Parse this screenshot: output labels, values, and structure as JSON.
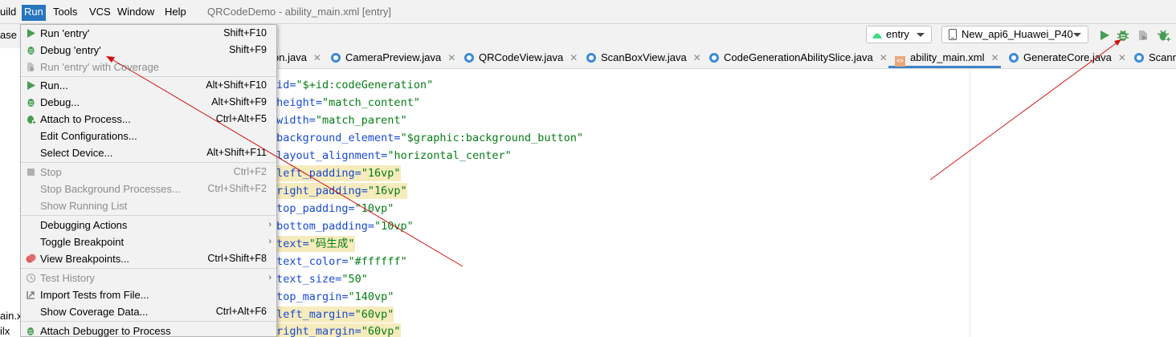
{
  "menubar": {
    "items": [
      "uild",
      "Run",
      "Tools",
      "VCS",
      "Window",
      "Help"
    ],
    "window_title": "QRCodeDemo - ability_main.xml [entry]"
  },
  "toolbar": {
    "left_text": "ase",
    "module_combo": "entry",
    "device_combo": "New_api6_Huawei_P40"
  },
  "tabs": [
    {
      "label": "on.java",
      "icon": "java-class-icon"
    },
    {
      "label": "CameraPreview.java",
      "icon": "java-class-icon"
    },
    {
      "label": "QRCodeView.java",
      "icon": "java-class-icon"
    },
    {
      "label": "ScanBoxView.java",
      "icon": "java-class-icon"
    },
    {
      "label": "CodeGenerationAbilitySlice.java",
      "icon": "java-class-icon"
    },
    {
      "label": "ability_main.xml",
      "icon": "xml-file-icon",
      "active": true
    },
    {
      "label": "GenerateCore.java",
      "icon": "java-class-icon"
    },
    {
      "label": "Scann",
      "icon": "java-class-icon"
    }
  ],
  "code": [
    {
      "attr": ":id=",
      "val": "\"$+id:codeGeneration\"",
      "hl": false
    },
    {
      "attr": ":height=",
      "val": "\"match_content\"",
      "hl": false
    },
    {
      "attr": ":width=",
      "val": "\"match_parent\"",
      "hl": false
    },
    {
      "attr": ":background_element=",
      "val": "\"$graphic:background_button\"",
      "hl": false
    },
    {
      "attr": ":layout_alignment=",
      "val": "\"horizontal_center\"",
      "hl": false
    },
    {
      "attr": ":left_padding=",
      "val": "\"16vp\"",
      "hl": true
    },
    {
      "attr": ":right_padding=",
      "val": "\"16vp\"",
      "hl": true
    },
    {
      "attr": ":top_padding=",
      "val": "\"10vp\"",
      "hl": false
    },
    {
      "attr": ":bottom_padding=",
      "val": "\"10vp\"",
      "hl": false
    },
    {
      "attr": ":text=",
      "val": "\"码生成\"",
      "hl": true
    },
    {
      "attr": ":text_color=",
      "val": "\"#ffffff\"",
      "hl": false
    },
    {
      "attr": ":text_size=",
      "val": "\"50\"",
      "hl": false
    },
    {
      "attr": ":top_margin=",
      "val": "\"140vp\"",
      "hl": false
    },
    {
      "attr": ":left_margin=",
      "val": "\"60vp\"",
      "hl": true
    },
    {
      "attr": ":right_margin=",
      "val": "\"60vp\"",
      "hl": true
    }
  ],
  "left_peek": {
    "line1": "ain.x",
    "line2": "ilx"
  },
  "run_menu": {
    "items": [
      {
        "label": "Run 'entry'",
        "shortcut": "Shift+F10",
        "icon": "run-icon",
        "disabled": false
      },
      {
        "label": "Debug 'entry'",
        "shortcut": "Shift+F9",
        "icon": "debug-icon",
        "disabled": false
      },
      {
        "label": "Run 'entry' with Coverage",
        "shortcut": "",
        "icon": "coverage-icon",
        "disabled": true
      },
      {
        "label": "Run...",
        "shortcut": "Alt+Shift+F10",
        "icon": "run-icon",
        "disabled": false
      },
      {
        "label": "Debug...",
        "shortcut": "Alt+Shift+F9",
        "icon": "debug-icon",
        "disabled": false
      },
      {
        "label": "Attach to Process...",
        "shortcut": "Ctrl+Alt+F5",
        "icon": "attach-icon",
        "disabled": false
      },
      {
        "label": "Edit Configurations...",
        "shortcut": "",
        "icon": "",
        "disabled": false
      },
      {
        "label": "Select Device...",
        "shortcut": "Alt+Shift+F11",
        "icon": "",
        "disabled": false
      },
      {
        "label": "Stop",
        "shortcut": "Ctrl+F2",
        "icon": "stop-icon",
        "disabled": true
      },
      {
        "label": "Stop Background Processes...",
        "shortcut": "Ctrl+Shift+F2",
        "icon": "",
        "disabled": true
      },
      {
        "label": "Show Running List",
        "shortcut": "",
        "icon": "",
        "disabled": true
      },
      {
        "label": "Debugging Actions",
        "shortcut": "",
        "icon": "",
        "disabled": false,
        "submenu": true
      },
      {
        "label": "Toggle Breakpoint",
        "shortcut": "",
        "icon": "",
        "disabled": false,
        "submenu": true
      },
      {
        "label": "View Breakpoints...",
        "shortcut": "Ctrl+Shift+F8",
        "icon": "breakpoints-icon",
        "disabled": false
      },
      {
        "label": "Test History",
        "shortcut": "",
        "icon": "history-icon",
        "disabled": true,
        "submenu": true
      },
      {
        "label": "Import Tests from File...",
        "shortcut": "",
        "icon": "import-icon",
        "disabled": false
      },
      {
        "label": "Show Coverage Data...",
        "shortcut": "Ctrl+Alt+F6",
        "icon": "",
        "disabled": false
      },
      {
        "label": "Attach Debugger to Process",
        "shortcut": "",
        "icon": "attach-debugger-icon",
        "disabled": false
      }
    ]
  },
  "colors": {
    "accent": "#2675bf",
    "annotation_arrow": "#d01010",
    "run_green": "#499c54",
    "highlight": "#f6ebbc"
  }
}
